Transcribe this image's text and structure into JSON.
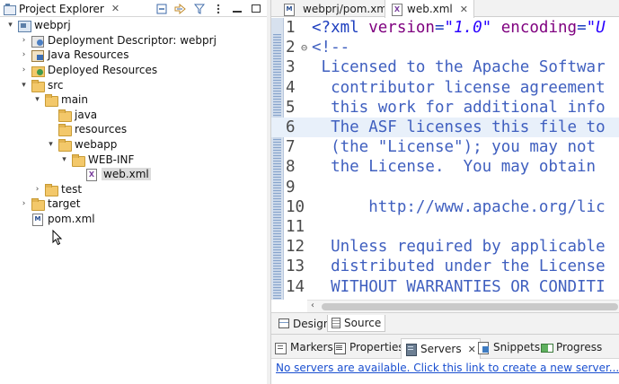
{
  "explorer": {
    "title": "Project Explorer",
    "close": "✕",
    "tree": [
      {
        "label": "webprj",
        "depth": 0,
        "twisty": "▾",
        "icon": "project-icon"
      },
      {
        "label": "Deployment Descriptor: webprj",
        "depth": 1,
        "twisty": "›",
        "icon": "deployment-descriptor-icon"
      },
      {
        "label": "Java Resources",
        "depth": 1,
        "twisty": "›",
        "icon": "java-resources-icon"
      },
      {
        "label": "Deployed Resources",
        "depth": 1,
        "twisty": "›",
        "icon": "deployed-resources-icon"
      },
      {
        "label": "src",
        "depth": 1,
        "twisty": "▾",
        "icon": "folder-icon"
      },
      {
        "label": "main",
        "depth": 2,
        "twisty": "▾",
        "icon": "folder-icon"
      },
      {
        "label": "java",
        "depth": 3,
        "twisty": "",
        "icon": "folder-icon"
      },
      {
        "label": "resources",
        "depth": 3,
        "twisty": "",
        "icon": "folder-icon"
      },
      {
        "label": "webapp",
        "depth": 3,
        "twisty": "▾",
        "icon": "folder-icon"
      },
      {
        "label": "WEB-INF",
        "depth": 4,
        "twisty": "▾",
        "icon": "folder-icon"
      },
      {
        "label": "web.xml",
        "depth": 5,
        "twisty": "",
        "icon": "xml-file-icon",
        "selected": true
      },
      {
        "label": "test",
        "depth": 2,
        "twisty": "›",
        "icon": "folder-icon"
      },
      {
        "label": "target",
        "depth": 1,
        "twisty": "›",
        "icon": "folder-icon"
      },
      {
        "label": "pom.xml",
        "depth": 1,
        "twisty": "",
        "icon": "maven-file-icon"
      }
    ]
  },
  "editor": {
    "tabs": [
      {
        "label": "webprj/pom.xml",
        "active": false
      },
      {
        "label": "web.xml",
        "active": true,
        "close": "✕"
      }
    ],
    "lines": [
      {
        "n": "1",
        "fold": "",
        "text": "<?xml version=\"1.0\" encoding=\"U"
      },
      {
        "n": "2",
        "fold": "⊖",
        "text": "<!--"
      },
      {
        "n": "3",
        "fold": "",
        "text": " Licensed to the Apache Softwar"
      },
      {
        "n": "4",
        "fold": "",
        "text": "  contributor license agreement"
      },
      {
        "n": "5",
        "fold": "",
        "text": "  this work for additional info"
      },
      {
        "n": "6",
        "fold": "",
        "text": "  The ASF licenses this file to"
      },
      {
        "n": "7",
        "fold": "",
        "text": "  (the \"License\"); you may not "
      },
      {
        "n": "8",
        "fold": "",
        "text": "  the License.  You may obtain "
      },
      {
        "n": "9",
        "fold": "",
        "text": ""
      },
      {
        "n": "10",
        "fold": "",
        "text": "      http://www.apache.org/lic"
      },
      {
        "n": "11",
        "fold": "",
        "text": ""
      },
      {
        "n": "12",
        "fold": "",
        "text": "  Unless required by applicable"
      },
      {
        "n": "13",
        "fold": "",
        "text": "  distributed under the License"
      },
      {
        "n": "14",
        "fold": "",
        "text": "  WITHOUT WARRANTIES OR CONDITI"
      }
    ],
    "page_tabs": [
      {
        "label": "Design",
        "active": false
      },
      {
        "label": "Source",
        "active": true
      }
    ]
  },
  "bottom": {
    "tabs": [
      {
        "label": "Markers",
        "icon": "markers-icon"
      },
      {
        "label": "Properties",
        "icon": "properties-icon"
      },
      {
        "label": "Servers",
        "icon": "servers-icon",
        "active": true,
        "close": "✕"
      },
      {
        "label": "Snippets",
        "icon": "snippets-icon"
      },
      {
        "label": "Progress",
        "icon": "progress-icon"
      }
    ],
    "servers_message": "No servers are available. Click this link to create a new server..."
  }
}
